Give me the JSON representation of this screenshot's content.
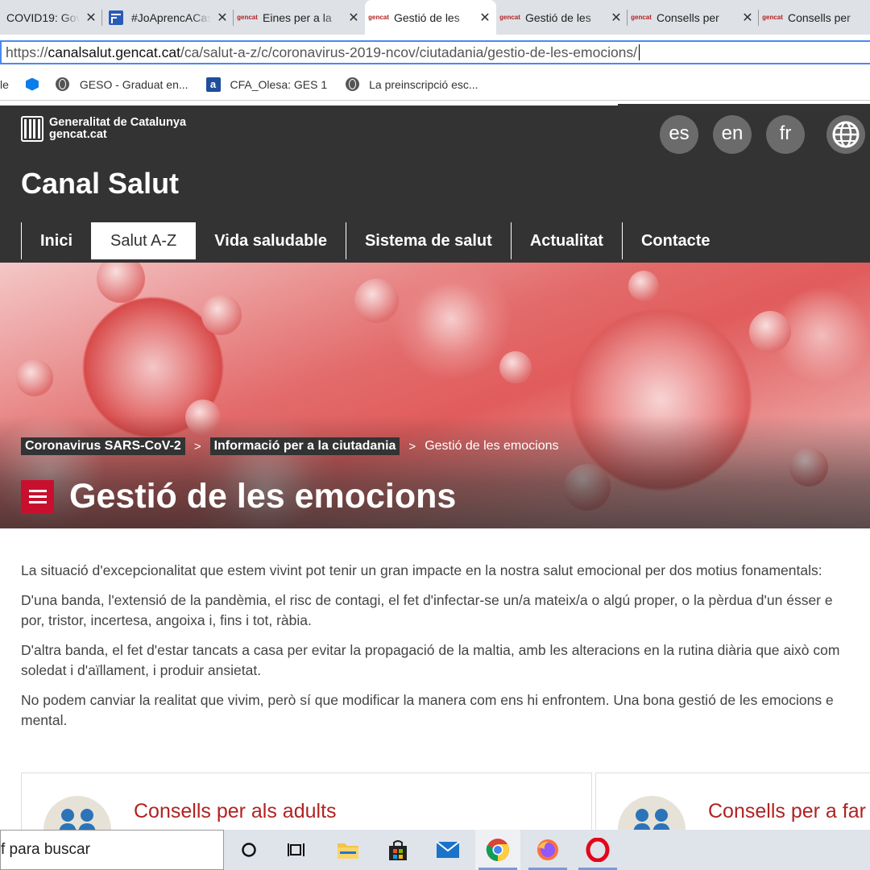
{
  "tabs": [
    {
      "title": "COVID19: Gov",
      "icon": "none"
    },
    {
      "title": "#JoAprencACasa",
      "icon": "blue-form"
    },
    {
      "title": "Eines per a la",
      "icon": "gencat"
    },
    {
      "title": "Gestió de les",
      "icon": "gencat"
    },
    {
      "title": "Gestió de les",
      "icon": "gencat"
    },
    {
      "title": "Consells per",
      "icon": "gencat"
    },
    {
      "title": "Consells per",
      "icon": "gencat"
    }
  ],
  "tab_close": "✕",
  "favicon_text": [
    "gen",
    "cat"
  ],
  "address": {
    "scheme": "https://",
    "host": "canalsalut.gencat.cat",
    "path": "/ca/salut-a-z/c/coronavirus-2019-ncov/ciutadania/gestio-de-les-emocions/"
  },
  "bookmarks": [
    {
      "label": "le",
      "icon": "none"
    },
    {
      "label": "",
      "icon": "hexagon"
    },
    {
      "label": "GESO - Graduat en...",
      "icon": "globe"
    },
    {
      "label": "CFA_Olesa: GES 1",
      "icon": "a-square"
    },
    {
      "label": "La preinscripció esc...",
      "icon": "globe"
    }
  ],
  "bookmark_a_letter": "a",
  "header": {
    "logo_line1": "Generalitat de Catalunya",
    "logo_line2": "gencat.cat",
    "site_title": "Canal Salut",
    "languages": [
      "es",
      "en",
      "fr"
    ]
  },
  "nav": [
    {
      "label": "Inici",
      "active": false
    },
    {
      "label": "Salut A-Z",
      "active": true
    },
    {
      "label": "Vida saludable",
      "active": false
    },
    {
      "label": "Sistema de salut",
      "active": false
    },
    {
      "label": "Actualitat",
      "active": false
    },
    {
      "label": "Contacte",
      "active": false
    }
  ],
  "breadcrumb": {
    "items": [
      "Coronavirus SARS-CoV-2",
      "Informació per a la ciutadania"
    ],
    "separator": ">",
    "current": "Gestió de les emocions"
  },
  "page_title": "Gestió de les emocions",
  "paragraphs": [
    "La situació d'excepcionalitat que estem vivint pot tenir un gran impacte en la nostra salut emocional per dos motius fonamentals:",
    "D'una banda, l'extensió de la pandèmia, el risc de contagi, el fet d'infectar-se un/a mateix/a o algú proper, o la pèrdua d'un ésser e",
    "por, tristor, incertesa, angoixa i, fins i tot, ràbia.",
    "D'altra banda, el fet d'estar tancats a casa per evitar la propagació de la maltia, amb les alteracions en la rutina diària que això com",
    "soledat i d'aïllament, i produir ansietat.",
    "No podem canviar la realitat que vivim, però sí que modificar la manera com ens hi enfrontem. Una bona gestió de les emocions e",
    "mental."
  ],
  "cards": [
    {
      "title": "Consells per als adults"
    },
    {
      "title": "Consells per a far"
    }
  ],
  "taskbar": {
    "search_text": "f para buscar"
  },
  "colors": {
    "header_bg": "#333333",
    "accent_red": "#c8102e",
    "link_red": "#b22222",
    "url_focus": "#4a89f0"
  }
}
